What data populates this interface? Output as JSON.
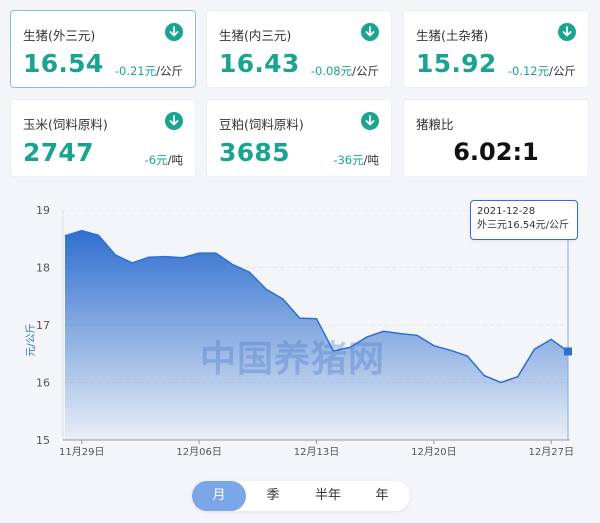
{
  "cards": [
    {
      "name": "生猪(外三元)",
      "price": "16.54",
      "delta": "-0.21元",
      "unit": "/公斤",
      "icon": "down-arrow-icon",
      "active": true
    },
    {
      "name": "生猪(内三元)",
      "price": "16.43",
      "delta": "-0.08元",
      "unit": "/公斤",
      "icon": "down-arrow-icon"
    },
    {
      "name": "生猪(土杂猪)",
      "price": "15.92",
      "delta": "-0.12元",
      "unit": "/公斤",
      "icon": "down-arrow-icon"
    },
    {
      "name": "玉米(饲料原料)",
      "price": "2747",
      "delta": "-6元",
      "unit": "/吨",
      "icon": "down-arrow-icon"
    },
    {
      "name": "豆粕(饲料原料)",
      "price": "3685",
      "delta": "-36元",
      "unit": "/吨",
      "icon": "down-arrow-icon"
    }
  ],
  "ratio_card": {
    "name": "猪粮比",
    "value": "6.02:1"
  },
  "colors": {
    "accent": "#1aa391",
    "line": "#2f6fd0",
    "tab_active": "#7ba6e8"
  },
  "tooltip": {
    "date": "2021-12-28",
    "text": "外三元16.54元/公斤"
  },
  "watermark": "中国养猪网",
  "tabs": [
    {
      "label": "月",
      "active": true
    },
    {
      "label": "季"
    },
    {
      "label": "半年"
    },
    {
      "label": "年"
    }
  ],
  "chart_data": {
    "type": "area",
    "ylabel": "元/公斤",
    "xlabel": "",
    "ylim": [
      15,
      19
    ],
    "yticks": [
      15,
      16,
      17,
      18,
      19
    ],
    "xticks": [
      {
        "label": "11月29日",
        "x": "2021-11-29"
      },
      {
        "label": "12月06日",
        "x": "2021-12-06"
      },
      {
        "label": "12月13日",
        "x": "2021-12-13"
      },
      {
        "label": "12月20日",
        "x": "2021-12-20"
      },
      {
        "label": "12月27日",
        "x": "2021-12-27"
      }
    ],
    "x": [
      "2021-11-28",
      "2021-11-29",
      "2021-11-30",
      "2021-12-01",
      "2021-12-02",
      "2021-12-03",
      "2021-12-04",
      "2021-12-05",
      "2021-12-06",
      "2021-12-07",
      "2021-12-08",
      "2021-12-09",
      "2021-12-10",
      "2021-12-11",
      "2021-12-12",
      "2021-12-13",
      "2021-12-14",
      "2021-12-15",
      "2021-12-16",
      "2021-12-17",
      "2021-12-18",
      "2021-12-19",
      "2021-12-20",
      "2021-12-21",
      "2021-12-22",
      "2021-12-23",
      "2021-12-24",
      "2021-12-25",
      "2021-12-26",
      "2021-12-27",
      "2021-12-28"
    ],
    "series": [
      {
        "values": [
          18.55,
          18.64,
          18.56,
          18.22,
          18.08,
          18.18,
          18.19,
          18.17,
          18.25,
          18.25,
          18.05,
          17.92,
          17.62,
          17.45,
          17.12,
          17.11,
          16.55,
          16.61,
          16.79,
          16.89,
          16.85,
          16.82,
          16.64,
          16.56,
          16.46,
          16.12,
          16.0,
          16.1,
          16.58,
          16.75,
          16.54
        ]
      }
    ],
    "grid": true,
    "legend": "none"
  }
}
